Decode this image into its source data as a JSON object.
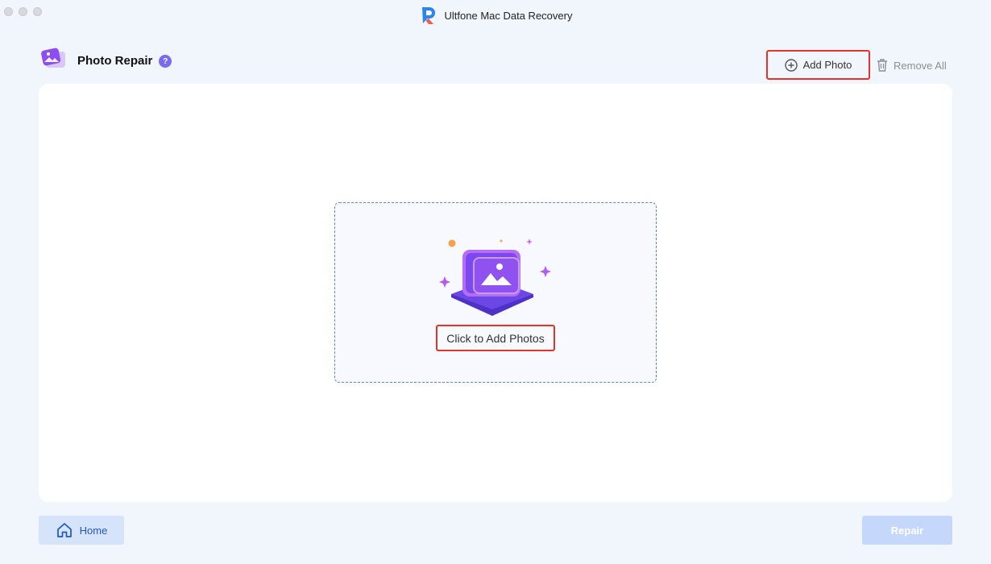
{
  "window": {
    "title": "Ultfone Mac Data Recovery"
  },
  "header": {
    "page_title": "Photo Repair",
    "help_glyph": "?"
  },
  "toolbar": {
    "add_photo_label": "Add Photo",
    "remove_all_label": "Remove All"
  },
  "dropzone": {
    "label": "Click to Add Photos"
  },
  "footer": {
    "home_label": "Home",
    "repair_label": "Repair"
  },
  "icons": {
    "app": "ultfone-logo-icon",
    "feature": "photo-repair-icon",
    "add": "plus-circle-icon",
    "remove": "trash-icon",
    "home": "home-icon",
    "illustration": "photo-stack-illustration"
  },
  "colors": {
    "accent": "#1f56c4",
    "highlight_box": "#e3342a",
    "help_badge": "#7a6cf0",
    "disabled_button": "#c5d8fb"
  }
}
